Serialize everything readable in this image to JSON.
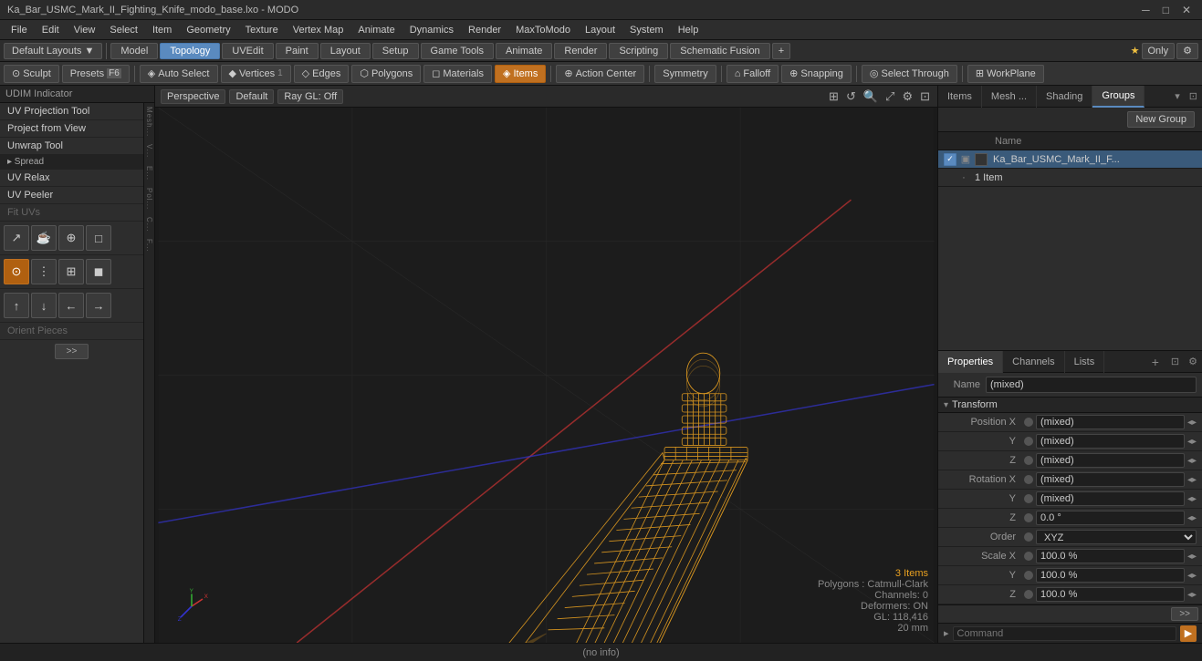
{
  "window": {
    "title": "Ka_Bar_USMC_Mark_II_Fighting_Knife_modo_base.lxo - MODO"
  },
  "titlebar": {
    "title": "Ka_Bar_USMC_Mark_II_Fighting_Knife_modo_base.lxo - MODO",
    "minimize": "─",
    "maximize": "□",
    "close": "✕"
  },
  "menubar": {
    "items": [
      "File",
      "Edit",
      "View",
      "Select",
      "Item",
      "Geometry",
      "Texture",
      "Vertex Map",
      "Animate",
      "Dynamics",
      "Render",
      "MaxToModo",
      "Layout",
      "System",
      "Help"
    ]
  },
  "toolbar1": {
    "layout_label": "Default Layouts ▼",
    "tabs": [
      "Model",
      "Topology",
      "UVEdit",
      "Paint",
      "Layout",
      "Setup",
      "Game Tools",
      "Animate",
      "Render",
      "Scripting",
      "Schematic Fusion"
    ],
    "active_tab": "Topology",
    "add_icon": "+",
    "star": "★",
    "only_label": "Only",
    "settings_icon": "⚙"
  },
  "toolbar2": {
    "sculpt_label": "Sculpt",
    "presets_label": "Presets",
    "f6_label": "F6",
    "auto_select": "Auto Select",
    "vertices": "Vertices",
    "edges": "Edges",
    "polygons": "Polygons",
    "materials": "Materials",
    "items": "Items",
    "action_center": "Action Center",
    "symmetry": "Symmetry",
    "falloff": "Falloff",
    "snapping": "Snapping",
    "select_through": "Select Through",
    "workplane": "WorkPlane"
  },
  "left_panel": {
    "header": "UDIM Indicator",
    "tools": [
      "UV Projection Tool",
      "Project from View",
      "Unwrap Tool",
      "▸ Spread",
      "UV Relax",
      "UV Peeler",
      "Fit UVs"
    ],
    "orient_label": "Orient Pieces",
    "more_btn": ">>"
  },
  "viewport": {
    "perspective_label": "Perspective",
    "default_label": "Default",
    "raygl_label": "Ray GL: Off",
    "info": {
      "items": "3 Items",
      "polygons": "Polygons : Catmull-Clark",
      "channels": "Channels: 0",
      "deformers": "Deformers: ON",
      "gl": "GL: 118,416",
      "size": "20 mm"
    }
  },
  "right_panel": {
    "tabs": [
      "Items",
      "Mesh ...",
      "Shading",
      "Groups"
    ],
    "active_tab": "Groups",
    "new_group_label": "New Group",
    "col_name": "Name",
    "tree": [
      {
        "name": "Ka_Bar_USMC_Mark_II_F...",
        "count": "",
        "indent": 0,
        "selected": true
      },
      {
        "name": "1 Item",
        "count": "",
        "indent": 1,
        "selected": false
      }
    ]
  },
  "properties": {
    "tabs": [
      "Properties",
      "Channels",
      "Lists"
    ],
    "active_tab": "Properties",
    "add_tab": "+",
    "name_label": "Name",
    "name_value": "(mixed)",
    "transform_section": "Transform",
    "fields": [
      {
        "group": "Position",
        "axis": "X",
        "value": "(mixed)"
      },
      {
        "group": "",
        "axis": "Y",
        "value": "(mixed)"
      },
      {
        "group": "",
        "axis": "Z",
        "value": "(mixed)"
      },
      {
        "group": "Rotation",
        "axis": "X",
        "value": "(mixed)"
      },
      {
        "group": "",
        "axis": "Y",
        "value": "(mixed)"
      },
      {
        "group": "",
        "axis": "Z",
        "value": "0.0 °"
      },
      {
        "group": "Order",
        "axis": "",
        "value": "XYZ"
      },
      {
        "group": "Scale",
        "axis": "X",
        "value": "100.0 %"
      },
      {
        "group": "",
        "axis": "Y",
        "value": "100.0 %"
      },
      {
        "group": "",
        "axis": "Z",
        "value": "100.0 %"
      }
    ]
  },
  "statusbar": {
    "text": "(no info)"
  },
  "command_bar": {
    "placeholder": "Command"
  }
}
